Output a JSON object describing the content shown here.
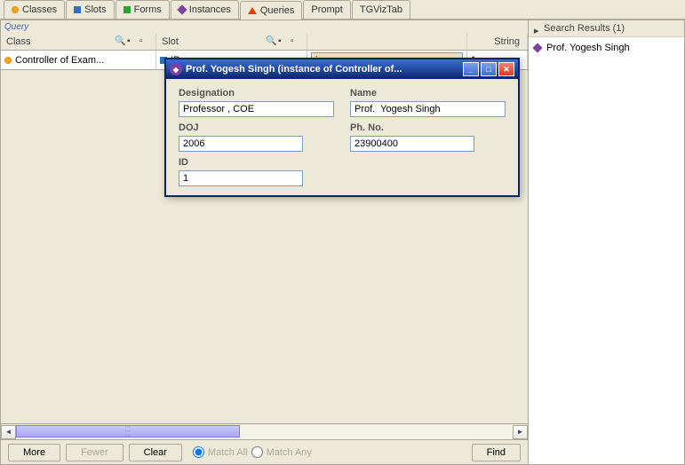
{
  "tabs": [
    {
      "label": "Classes",
      "icon": "orange"
    },
    {
      "label": "Slots",
      "icon": "blue"
    },
    {
      "label": "Forms",
      "icon": "green"
    },
    {
      "label": "Instances",
      "icon": "purple2"
    },
    {
      "label": "Queries",
      "icon": "red-tri",
      "active": true
    },
    {
      "label": "Prompt"
    },
    {
      "label": "TGVizTab"
    }
  ],
  "query": {
    "section_label": "Query",
    "headers": {
      "class": "Class",
      "slot": "Slot",
      "string": "String"
    },
    "row": {
      "class_value": "Controller of Exam...",
      "slot_value": "ID",
      "op_options": [
        "is"
      ],
      "op_selected": "is",
      "str_value": "1"
    }
  },
  "buttons": {
    "more": "More",
    "fewer": "Fewer",
    "clear": "Clear",
    "match_all": "Match All",
    "match_any": "Match Any",
    "find": "Find"
  },
  "search": {
    "title": "Search Results (1)",
    "items": [
      "Prof.  Yogesh Singh"
    ]
  },
  "dialog": {
    "title": "Prof.  Yogesh Singh   (instance of Controller of...",
    "fields": {
      "designation": {
        "label": "Designation",
        "value": "Professor , COE"
      },
      "name": {
        "label": "Name",
        "value": "Prof.  Yogesh Singh"
      },
      "doj": {
        "label": "DOJ",
        "value": "2006"
      },
      "phone": {
        "label": "Ph. No.",
        "value": "23900400"
      },
      "id": {
        "label": "ID",
        "value": "1"
      }
    }
  }
}
